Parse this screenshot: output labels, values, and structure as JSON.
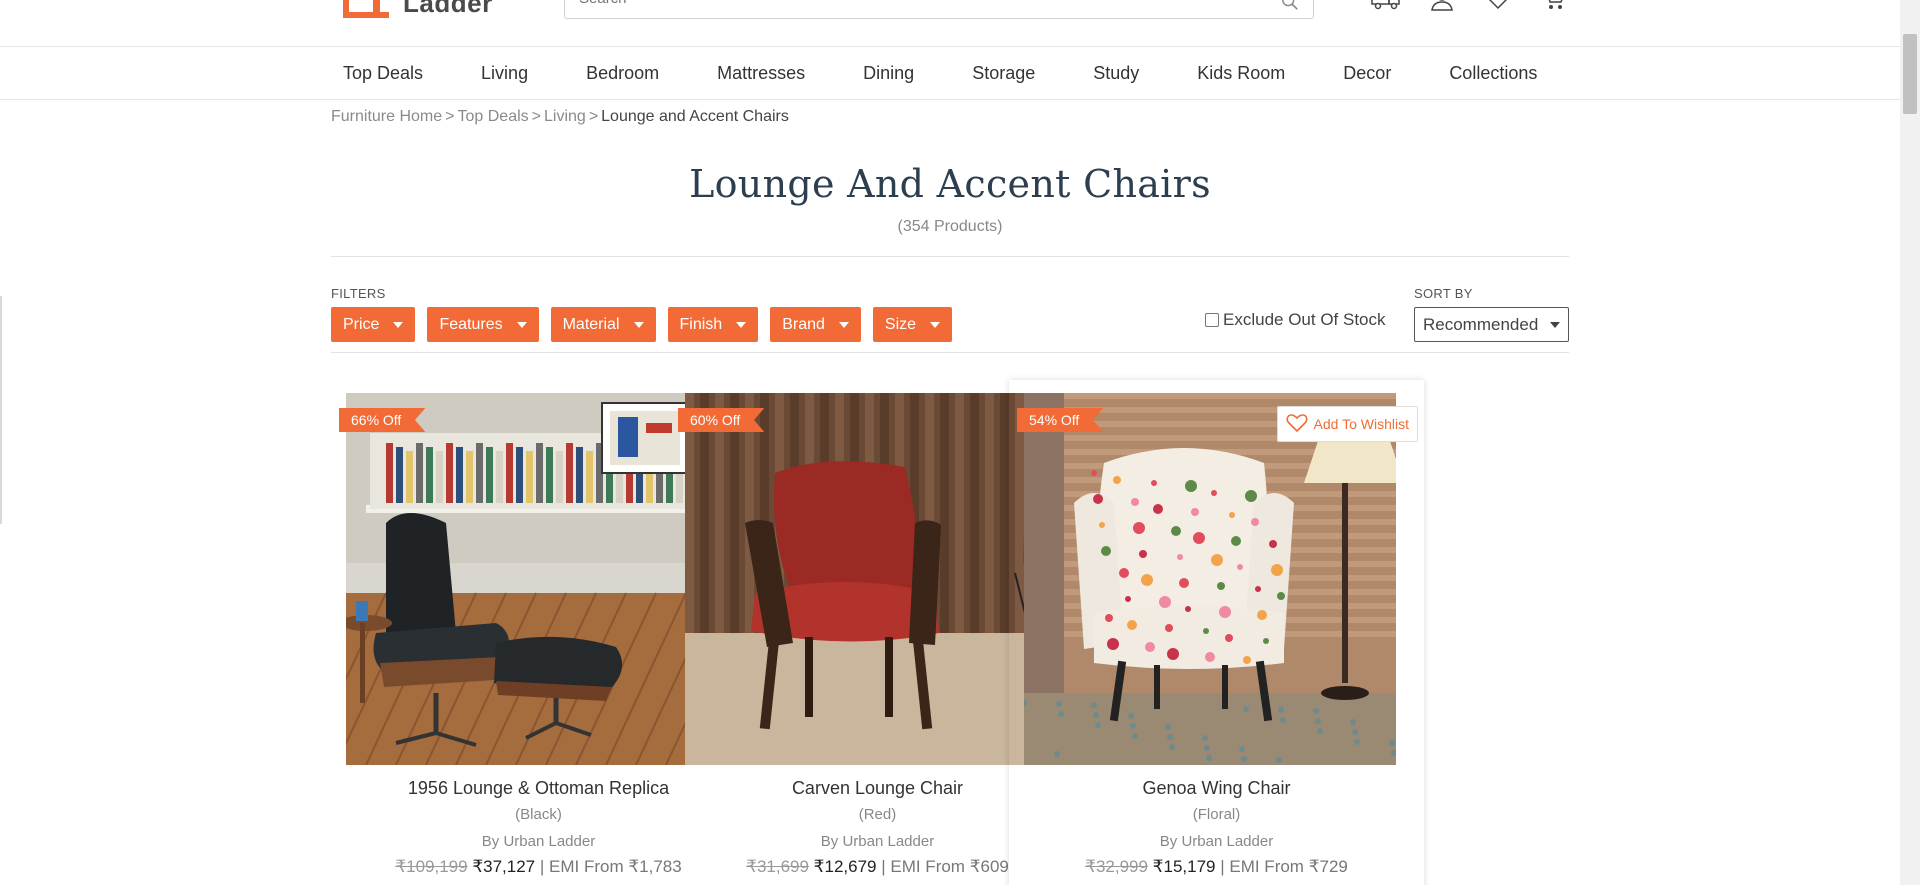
{
  "header": {
    "logo_text": "Ladder",
    "search_placeholder": "Search",
    "icons": [
      "truck-icon",
      "user-icon",
      "heart-icon",
      "cart-icon"
    ]
  },
  "nav": {
    "items": [
      "Top Deals",
      "Living",
      "Bedroom",
      "Mattresses",
      "Dining",
      "Storage",
      "Study",
      "Kids Room",
      "Decor",
      "Collections"
    ]
  },
  "breadcrumb": {
    "items": [
      "Furniture Home",
      "Top Deals",
      "Living"
    ],
    "separator": ">",
    "current": "Lounge and Accent Chairs"
  },
  "page": {
    "title": "Lounge And Accent Chairs",
    "count": "(354 Products)"
  },
  "filters": {
    "label": "FILTERS",
    "buttons": [
      "Price",
      "Features",
      "Material",
      "Finish",
      "Brand",
      "Size"
    ],
    "exclude_label": "Exclude Out Of Stock",
    "exclude_checked": false
  },
  "sort": {
    "label": "SORT BY",
    "selected": "Recommended"
  },
  "products": [
    {
      "badge": "66% Off",
      "name": "1956 Lounge & Ottoman Replica",
      "variant": "(Black)",
      "brand": "By Urban Ladder",
      "mrp": "₹109,199",
      "price": "₹37,127",
      "emi": "| EMI From ₹1,783",
      "wishlist_label": ""
    },
    {
      "badge": "60% Off",
      "name": "Carven Lounge Chair",
      "variant": "(Red)",
      "brand": "By Urban Ladder",
      "mrp": "₹31,699",
      "price": "₹12,679",
      "emi": "| EMI From ₹609",
      "wishlist_label": ""
    },
    {
      "badge": "54% Off",
      "name": "Genoa Wing Chair",
      "variant": "(Floral)",
      "brand": "By Urban Ladder",
      "mrp": "₹32,999",
      "price": "₹15,179",
      "emi": "| EMI From ₹729",
      "wishlist_label": "Add To Wishlist"
    }
  ],
  "colors": {
    "accent": "#f26b36",
    "title": "#2c3e50"
  }
}
